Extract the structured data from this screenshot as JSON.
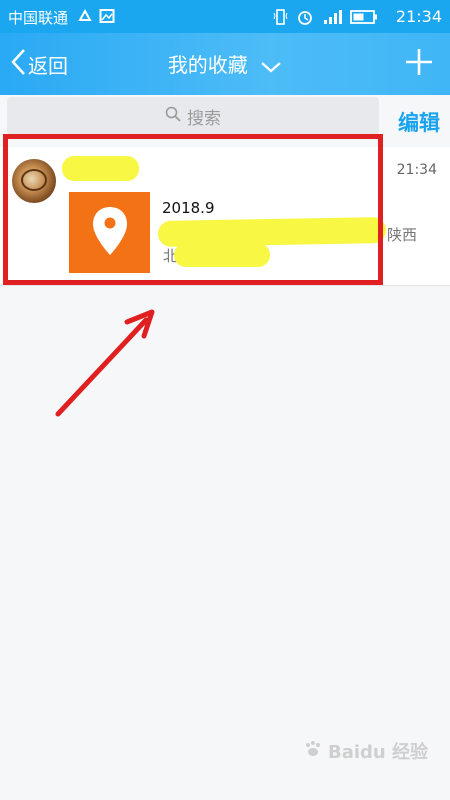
{
  "status_bar": {
    "carrier": "中国联通",
    "time": "21:34"
  },
  "navbar": {
    "back_label": "返回",
    "title": "我的收藏"
  },
  "search": {
    "placeholder": "搜索"
  },
  "toolbar": {
    "edit_label": "编辑"
  },
  "favorite_item": {
    "date_text": "2018.9",
    "time": "21:34",
    "address_start": "北",
    "address_end": ")",
    "address_tail": "陕西"
  },
  "watermark": "Baidu 经验",
  "colors": {
    "accent": "#1aa7ef",
    "thumb": "#f47216",
    "highlight": "#e02020",
    "redaction": "#f7f744"
  }
}
